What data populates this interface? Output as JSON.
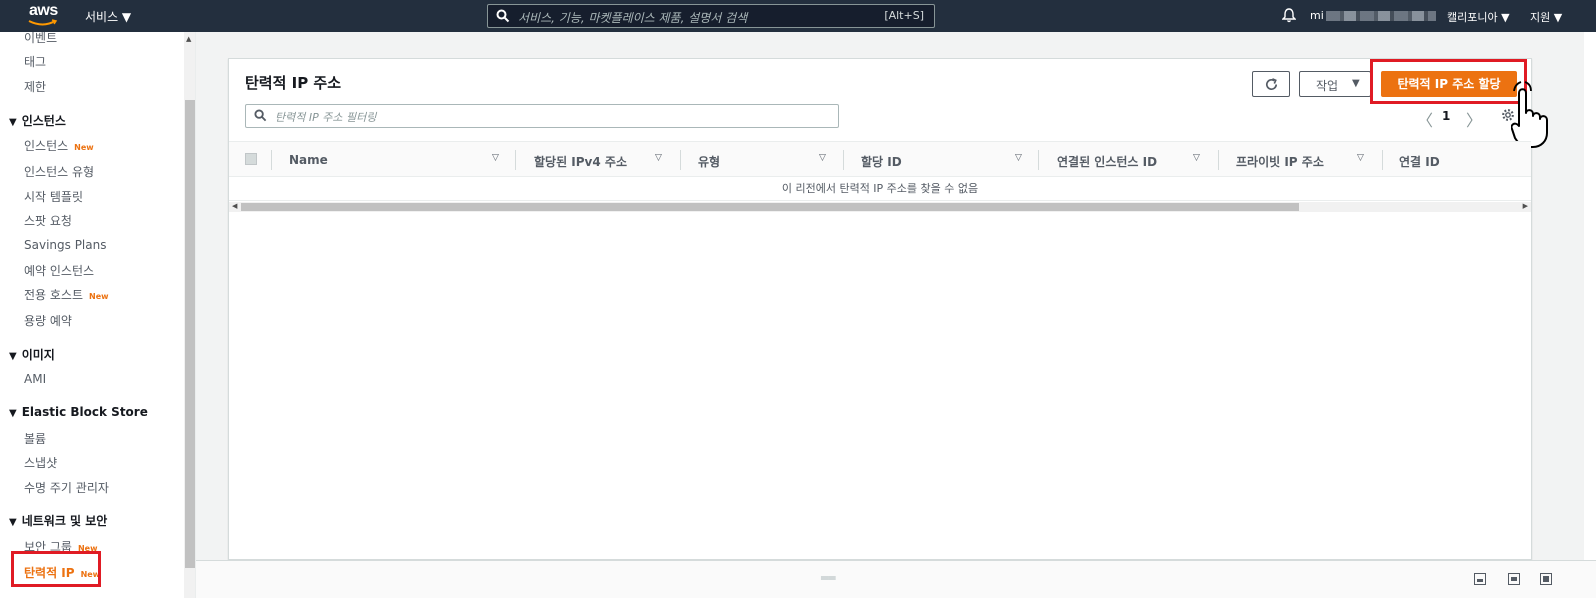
{
  "topnav": {
    "logo": "aws",
    "services_label": "서비스 ▼",
    "search_placeholder": "서비스, 기능, 마켓플레이스 제품, 설명서 검색",
    "search_shortcut": "[Alt+S]",
    "account_prefix": "mi",
    "region_label": "캘리포니아 ▼",
    "support_label": "지원 ▼",
    "icons": [
      "search-icon",
      "bell-icon"
    ]
  },
  "sidebar": {
    "items_top": [
      {
        "label": "이벤트"
      },
      {
        "label": "태그"
      },
      {
        "label": "제한"
      }
    ],
    "sections": [
      {
        "title": "인스턴스",
        "items": [
          {
            "label": "인스턴스",
            "badge": "New"
          },
          {
            "label": "인스턴스 유형",
            "badge": ""
          },
          {
            "label": "시작 템플릿",
            "badge": ""
          },
          {
            "label": "스팟 요청",
            "badge": ""
          },
          {
            "label": "Savings Plans",
            "badge": ""
          },
          {
            "label": "예약 인스턴스",
            "badge": ""
          },
          {
            "label": "전용 호스트",
            "badge": "New"
          },
          {
            "label": "용량 예약",
            "badge": ""
          }
        ]
      },
      {
        "title": "이미지",
        "items": [
          {
            "label": "AMI",
            "badge": ""
          }
        ]
      },
      {
        "title": "Elastic Block Store",
        "items": [
          {
            "label": "볼륨",
            "badge": ""
          },
          {
            "label": "스냅샷",
            "badge": ""
          },
          {
            "label": "수명 주기 관리자",
            "badge": ""
          }
        ]
      },
      {
        "title": "네트워크 및 보안",
        "items": [
          {
            "label": "보안 그룹",
            "badge": "New"
          },
          {
            "label": "탄력적 IP",
            "badge": "New",
            "active": true
          }
        ]
      }
    ]
  },
  "main": {
    "title": "탄력적 IP 주소",
    "filter_placeholder": "탄력적 IP 주소 필터링",
    "actions_label": "작업",
    "allocate_label": "탄력적 IP 주소 할당",
    "page_number": "1",
    "prev_label": "〈",
    "next_label": "〉",
    "columns": [
      "Name",
      "할당된 IPv4 주소",
      "유형",
      "할당 ID",
      "연결된 인스턴스 ID",
      "프라이빗 IP 주소",
      "연결 ID"
    ],
    "empty_message": "이 리전에서 탄력적 IP 주소를 찾을 수 없음",
    "accent_color": "#ec7211",
    "highlight_color": "#e01b24"
  },
  "bottombar": {
    "handle": "══"
  }
}
